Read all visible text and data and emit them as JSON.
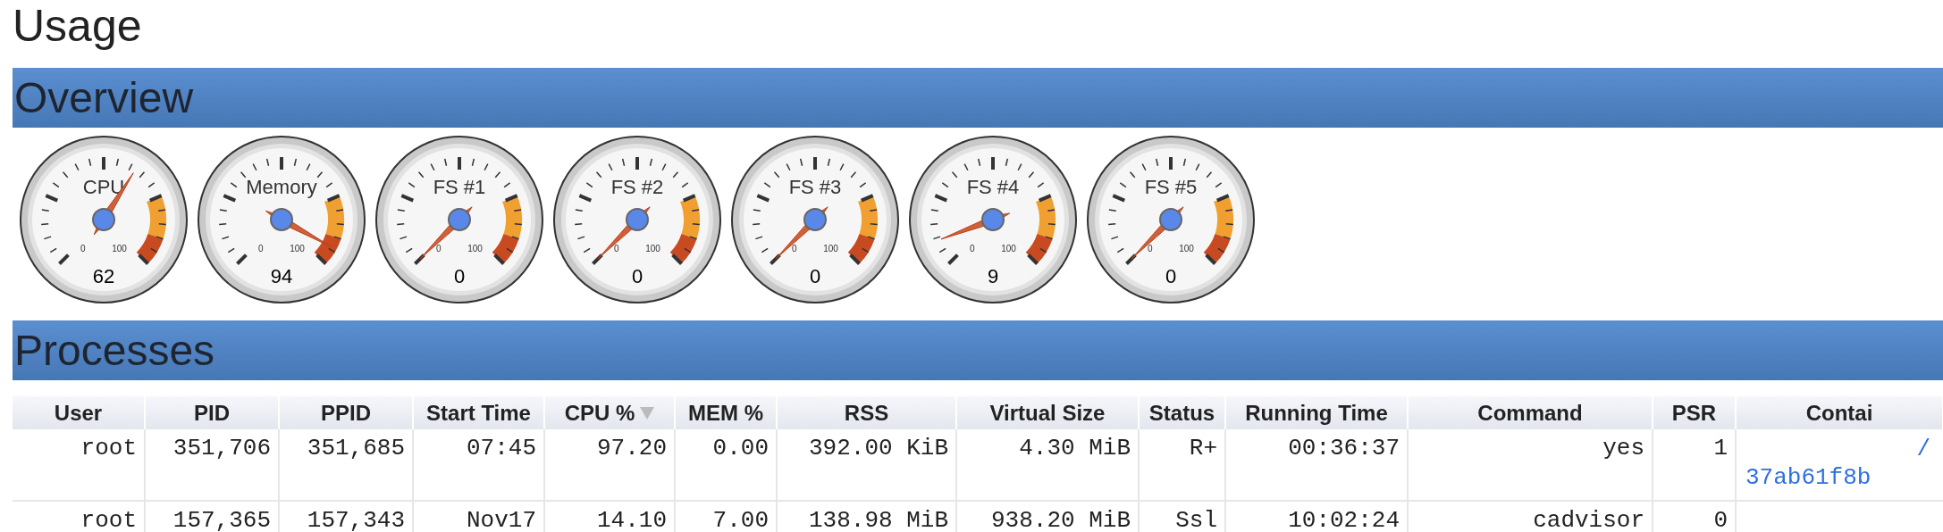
{
  "title": "Usage",
  "overview": {
    "heading": "Overview",
    "gauges": [
      {
        "label": "CPU",
        "value": "62",
        "min_label": "0",
        "max_label": "100"
      },
      {
        "label": "Memory",
        "value": "94",
        "min_label": "0",
        "max_label": "100"
      },
      {
        "label": "FS #1",
        "value": "0",
        "min_label": "0",
        "max_label": "100"
      },
      {
        "label": "FS #2",
        "value": "0",
        "min_label": "0",
        "max_label": "100"
      },
      {
        "label": "FS #3",
        "value": "0",
        "min_label": "0",
        "max_label": "100"
      },
      {
        "label": "FS #4",
        "value": "9",
        "min_label": "0",
        "max_label": "100"
      },
      {
        "label": "FS #5",
        "value": "0",
        "min_label": "0",
        "max_label": "100"
      }
    ]
  },
  "processes": {
    "heading": "Processes",
    "table": {
      "columns": [
        {
          "label": "User",
          "sorted": false
        },
        {
          "label": "PID",
          "sorted": false
        },
        {
          "label": "PPID",
          "sorted": false
        },
        {
          "label": "Start Time",
          "sorted": false
        },
        {
          "label": "CPU %",
          "sorted": true
        },
        {
          "label": "MEM %",
          "sorted": false
        },
        {
          "label": "RSS",
          "sorted": false
        },
        {
          "label": "Virtual Size",
          "sorted": false
        },
        {
          "label": "Status",
          "sorted": false
        },
        {
          "label": "Running Time",
          "sorted": false
        },
        {
          "label": "Command",
          "sorted": false
        },
        {
          "label": "PSR",
          "sorted": false
        },
        {
          "label": "Contai",
          "sorted": false
        }
      ],
      "rows": [
        {
          "cells": [
            "root",
            "351,706",
            "351,685",
            "07:45",
            "97.20",
            "0.00",
            "392.00 KiB",
            "4.30 MiB",
            "R+",
            "00:36:37",
            "yes",
            "1"
          ],
          "container": [
            "/",
            "37ab61f8b"
          ]
        },
        {
          "cells": [
            "root",
            "157,365",
            "157,343",
            "Nov17",
            "14.10",
            "7.00",
            "138.98 MiB",
            "938.20 MiB",
            "Ssl",
            "10:02:24",
            "cadvisor",
            "0"
          ],
          "container": []
        }
      ]
    }
  }
}
